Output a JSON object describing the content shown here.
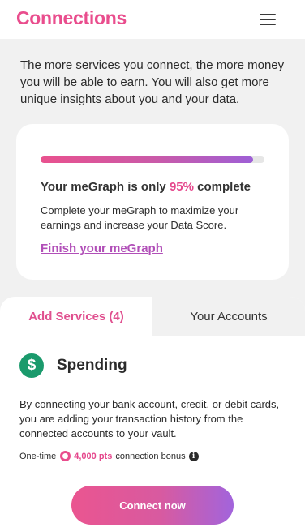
{
  "header": {
    "title": "Connections",
    "menu_icon": "hamburger-menu-icon"
  },
  "intro": {
    "text": "The more services you connect, the more money you will be able to earn. You will also get more unique insights about you and your data."
  },
  "progress_card": {
    "title_prefix": "Your meGraph is only",
    "percent_label": "95%",
    "title_suffix": "complete",
    "progress_value": 0.95,
    "description": "Complete your meGraph to maximize your earnings and increase your Data Score.",
    "link_label": "Finish your meGraph"
  },
  "tabs": [
    {
      "label": "Add Services (4)",
      "active": true
    },
    {
      "label": "Your Accounts",
      "active": false
    }
  ],
  "service": {
    "icon": "dollar-icon",
    "icon_glyph": "$",
    "title": "Spending",
    "description": "By connecting your bank account, credit, or debit cards, you are adding your transaction history from the connected accounts to your vault.",
    "bonus_prefix": "One-time",
    "bonus_points": "4,000 pts",
    "bonus_suffix": "connection bonus",
    "info_glyph": "i",
    "button_label": "Connect now"
  },
  "colors": {
    "brand": "#e94d8d",
    "link": "#b14fb8",
    "service_icon": "#1a9a6c",
    "gradient_start": "#ea5590",
    "gradient_end": "#a264dc"
  }
}
